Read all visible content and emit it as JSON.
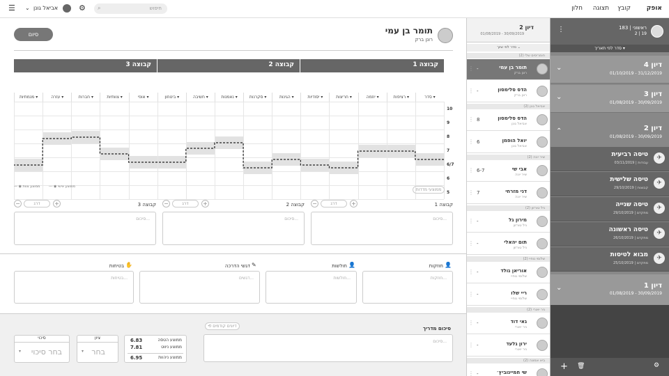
{
  "topbar": {
    "menu": [
      "אופק",
      "קובץ",
      "תצוגה",
      "חלון"
    ],
    "user": "אביאל גונן",
    "search_placeholder": "חיפוש"
  },
  "right": {
    "header_title": "ראשוני | 183",
    "header_sub": "2 | 19",
    "sort": "סדר לפי תאריך",
    "items": [
      {
        "title": "דיון 4",
        "date": "01/10/2019 - 31/12/2019",
        "chev": "⌄"
      },
      {
        "title": "דיון 3",
        "date": "01/08/2019 - 30/09/2019",
        "chev": "⌄"
      },
      {
        "title": "דיון 2",
        "date": "01/08/2019 - 30/09/2019",
        "chev": "⌃"
      },
      {
        "title": "דיון 1",
        "date": "01/08/2019 - 30/09/2019",
        "chev": "⌄"
      }
    ],
    "flights": [
      {
        "title": "טיסה רביעית",
        "meta": "03/11/2019 | עבודות"
      },
      {
        "title": "טיסה שלישית",
        "meta": "29/10/2019 | קבוצות"
      },
      {
        "title": "טיסה שנייה",
        "meta": "29/10/2019 | מתקדם"
      },
      {
        "title": "טיסה ראשונה",
        "meta": "26/10/2019 | מתקדם"
      },
      {
        "title": "מבוא לטיסות",
        "meta": "25/10/2019 | מתקדם"
      }
    ]
  },
  "mid": {
    "title": "דיון 2",
    "date": "01/08/2019 - 30/09/2019",
    "sort": "סדר לפי שיוך",
    "cats": [
      "חומריסים שלי (2)",
      "אביאל גונן (2)",
      "שיר יונה (2)",
      "ניל טורזון (2)",
      "שלומי נוחיי (2)",
      "ניר יאורי (2)",
      "ביא אמונה (2)"
    ],
    "people": [
      {
        "name": "תומר בן עמי",
        "sub": "רונן ברק",
        "grade": "-"
      },
      {
        "name": "הדס סלימסון",
        "sub": "רונן ברק",
        "grade": "-"
      },
      {
        "name": "הדס סלימסון",
        "sub": "אביאל גונן",
        "grade": "8"
      },
      {
        "name": "יואל הופמן",
        "sub": "אביאל גונן",
        "grade": "6"
      },
      {
        "name": "אבי שי",
        "sub": "שיר יונה",
        "grade": "6-7"
      },
      {
        "name": "דני מזרחי",
        "sub": "שיר יונה",
        "grade": "7"
      },
      {
        "name": "מירון גל",
        "sub": "ניל טורזון",
        "grade": "-"
      },
      {
        "name": "תום יהאלי",
        "sub": "ניל טורזון",
        "grade": "-"
      },
      {
        "name": "אוריאן גולד",
        "sub": "שלומי נוחיי",
        "grade": "-"
      },
      {
        "name": "ריי שלו",
        "sub": "שלומי נוחיי",
        "grade": "-"
      },
      {
        "name": "גאי דוד",
        "sub": "ניר יאורי",
        "grade": "-"
      },
      {
        "name": "ירון גלעד",
        "sub": "ניר יאורי",
        "grade": "-"
      },
      {
        "name": "שי חמיינוביץ׳",
        "sub": "ביא אמונה",
        "grade": "-"
      }
    ]
  },
  "student": {
    "name": "תומר בן עמי",
    "instructor": "רונן ברק",
    "done": "סיום"
  },
  "groups": [
    "קבוצה 1",
    "קבוצה 2",
    "קבוצה 3"
  ],
  "cols": [
    "סדר",
    "רציפות",
    "יוזמה",
    "חריצות",
    "יסודיות",
    "הגינות",
    "סקרנות",
    "נאמנות",
    "חשיבה",
    "ביטחון",
    "אופי",
    "צוותיות",
    "חברות",
    "עזרה",
    "מנמתיות"
  ],
  "rows": [
    "10",
    "9",
    "8",
    "7",
    "6/7",
    "6",
    "5"
  ],
  "legend": {
    "a": "ממוצע אישי",
    "b": "ממוצע צוות"
  },
  "avgbtn": "ממוצעי מדדות",
  "sections": [
    {
      "title": "קבוצה 1",
      "ph": "סיכום...",
      "pill": "דרג"
    },
    {
      "title": "קבוצה 2",
      "ph": "סיכום...",
      "pill": "דרג"
    },
    {
      "title": "קבוצה 3",
      "ph": "סיכום...",
      "pill": "דרג"
    }
  ],
  "bottom": [
    {
      "title": "חוזקות",
      "ph": "חוזקות..."
    },
    {
      "title": "חולשות",
      "ph": "חולשות..."
    },
    {
      "title": "דגשי הדרכה",
      "ph": "דגשים..."
    },
    {
      "title": "בטיחות",
      "ph": "בטיחות..."
    }
  ],
  "summary": {
    "title": "סיכום מדריך",
    "ph": "סיכום...",
    "prev": "דיונים קודמים"
  },
  "stats": [
    {
      "label": "ממוצע הטסה",
      "value": "6.83"
    },
    {
      "label": "ממוצע ניווט",
      "value": "7.81"
    },
    {
      "label": "ממוצע ניהוות",
      "value": "6.95"
    }
  ],
  "grade": {
    "label": "ציון",
    "value": "בחר"
  },
  "risk": {
    "label": "סיכוי",
    "value": "בחר סיכוי"
  },
  "chart_data": {
    "type": "line",
    "categories": [
      "סדר",
      "רציפות",
      "יוזמה",
      "חריצות",
      "יסודיות",
      "הגינות",
      "סקרנות",
      "נאמנות",
      "חשיבה",
      "ביטחון",
      "אופי",
      "צוותיות",
      "חברות",
      "עזרה",
      "מנמתיות"
    ],
    "y_ticks": [
      "10",
      "9",
      "8",
      "7",
      "6/7",
      "6",
      "5"
    ],
    "series": [
      {
        "name": "ממוצע אישי",
        "values": [
          6.7,
          7,
          7,
          6.4,
          6.5,
          6.7,
          6.4,
          7.6,
          7.2,
          6.6,
          6.6,
          6.9,
          8,
          7.9,
          6.5
        ]
      }
    ]
  }
}
